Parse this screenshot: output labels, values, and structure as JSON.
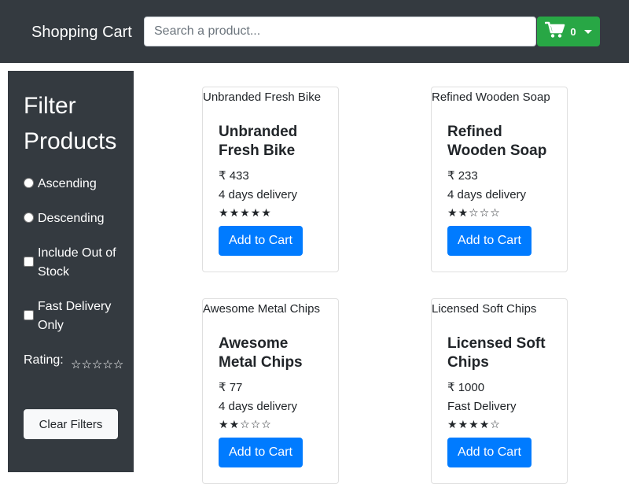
{
  "header": {
    "brand": "Shopping Cart",
    "search_placeholder": "Search a product...",
    "cart_count": "0"
  },
  "sidebar": {
    "title": "Filter Products",
    "options": {
      "ascending": "Ascending",
      "descending": "Descending",
      "out_of_stock": "Include Out of Stock",
      "fast_delivery": "Fast Delivery Only"
    },
    "rating_label": "Rating:",
    "rating_value": 0,
    "clear_label": "Clear Filters"
  },
  "products": [
    {
      "name": "Unbranded Fresh Bike",
      "price": "₹ 433",
      "delivery": "4 days delivery",
      "rating": 5,
      "button": "Add to Cart"
    },
    {
      "name": "Refined Wooden Soap",
      "price": "₹ 233",
      "delivery": "4 days delivery",
      "rating": 2,
      "button": "Add to Cart"
    },
    {
      "name": "Awesome Metal Chips",
      "price": "₹ 77",
      "delivery": "4 days delivery",
      "rating": 2,
      "button": "Add to Cart"
    },
    {
      "name": "Licensed Soft Chips",
      "price": "₹ 1000",
      "delivery": "Fast Delivery",
      "rating": 4,
      "button": "Add to Cart"
    }
  ],
  "colors": {
    "navbar": "#343a40",
    "cart_button": "#28a745",
    "add_button": "#007bff",
    "clear_button": "#f8f9fa"
  },
  "icons": {
    "cart": "shopping-cart-icon",
    "dropdown": "caret-down-icon",
    "star": "star-icon"
  }
}
